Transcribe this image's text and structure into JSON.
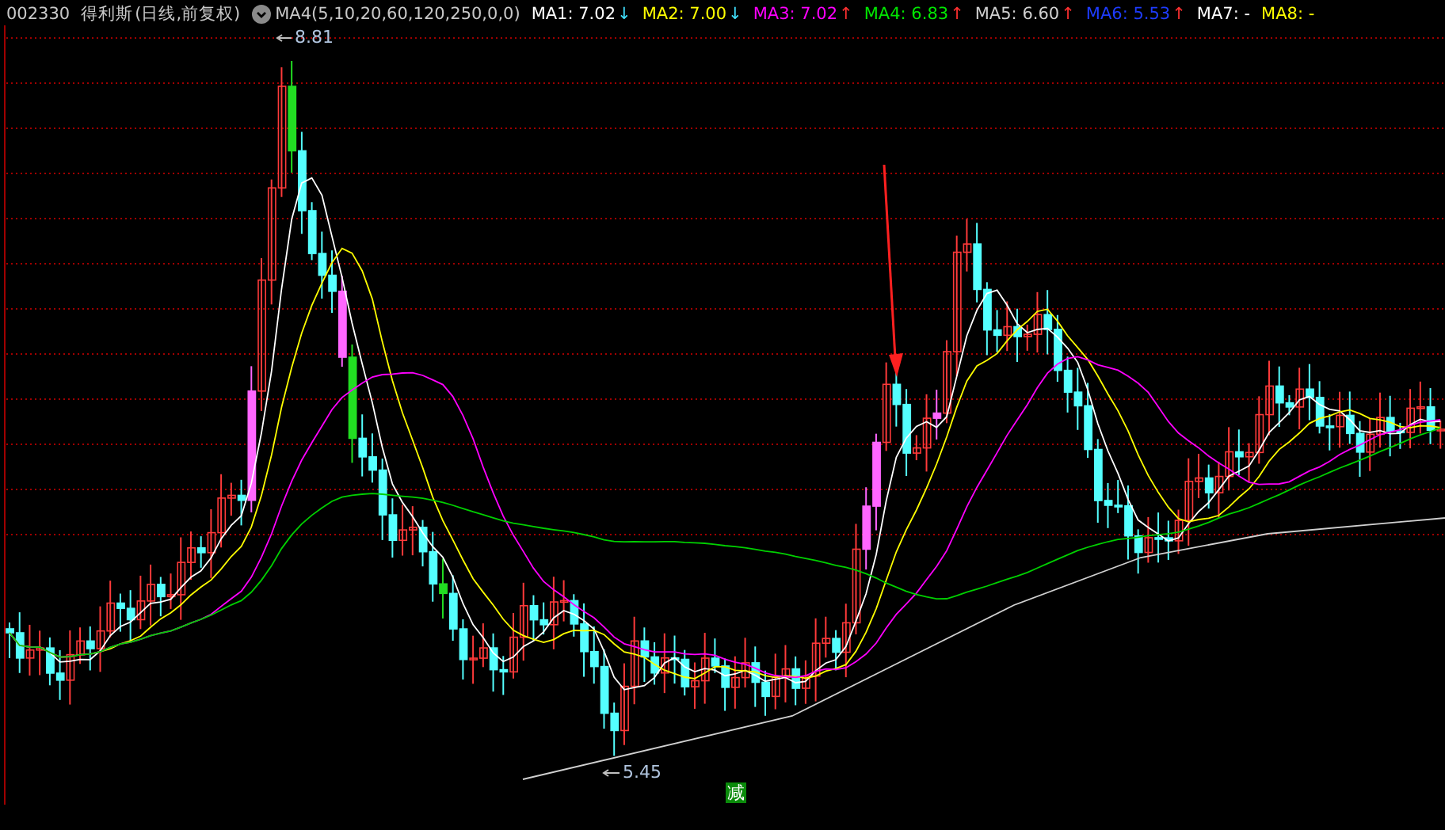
{
  "header": {
    "code": "002330",
    "name": "得利斯",
    "period": "(日线,前复权)",
    "indicator": "MA4(5,10,20,60,120,250,0,0)",
    "ma": [
      {
        "label": "MA1:",
        "value": "7.02",
        "arrow": {
          "text": "↓",
          "color": "#40e0ff"
        },
        "color": "#ffffff"
      },
      {
        "label": "MA2:",
        "value": "7.00",
        "arrow": {
          "text": "↓",
          "color": "#40e0ff"
        },
        "color": "#ffff00"
      },
      {
        "label": "MA3:",
        "value": "7.02",
        "arrow": {
          "text": "↑",
          "color": "#ff3030"
        },
        "color": "#ff00ff"
      },
      {
        "label": "MA4:",
        "value": "6.83",
        "arrow": {
          "text": "↑",
          "color": "#ff3030"
        },
        "color": "#00e600"
      },
      {
        "label": "MA5:",
        "value": "6.60",
        "arrow": {
          "text": "↑",
          "color": "#ff3030"
        },
        "color": "#d0d0d0"
      },
      {
        "label": "MA6:",
        "value": "5.53",
        "arrow": {
          "text": "↑",
          "color": "#ff3030"
        },
        "color": "#1e3cff"
      },
      {
        "label": "MA7:",
        "value": "-",
        "color": "#ffffff"
      },
      {
        "label": "MA8:",
        "value": "-",
        "color": "#ffff00"
      }
    ]
  },
  "chart": {
    "high_label": "8.81",
    "low_label": "5.45",
    "badge": "减"
  }
}
